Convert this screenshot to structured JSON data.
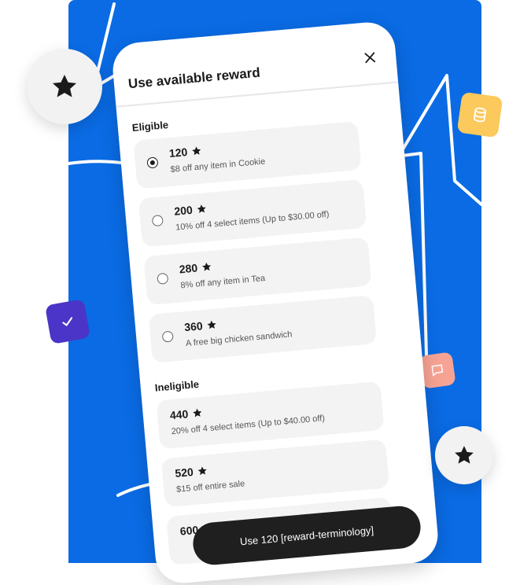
{
  "modal": {
    "title": "Use available reward",
    "close_icon": "close-icon"
  },
  "sections": {
    "eligible_label": "Eligible",
    "ineligible_label": "Ineligible"
  },
  "eligible": [
    {
      "points": "120",
      "description": "$8 off any item in Cookie",
      "selected": true
    },
    {
      "points": "200",
      "description": "10% off 4 select items (Up to $30.00 off)",
      "selected": false
    },
    {
      "points": "280",
      "description": "8% off any item in Tea",
      "selected": false
    },
    {
      "points": "360",
      "description": "A free big chicken sandwich",
      "selected": false
    }
  ],
  "ineligible": [
    {
      "points": "440",
      "description": "20% off 4 select items (Up to $40.00 off)"
    },
    {
      "points": "520",
      "description": "$15 off entire sale"
    },
    {
      "points": "600",
      "description": ""
    }
  ],
  "cta": {
    "label": "Use 120 [reward-terminology]"
  },
  "decorations": {
    "badge_icon": "star-icon",
    "tile_icons": [
      "database-icon",
      "check-icon",
      "chat-icon"
    ]
  },
  "colors": {
    "background_blue": "#0a6be4",
    "tile_yellow": "#fbc95c",
    "tile_purple": "#4a35c8",
    "tile_pink": "#f7a393",
    "cta_dark": "#1f1f1f"
  }
}
